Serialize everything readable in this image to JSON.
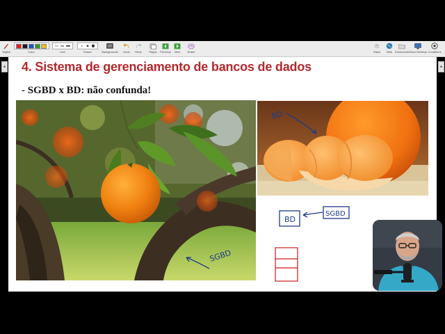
{
  "toolbar": {
    "items": [
      {
        "label": "Digital",
        "icon": "pen-icon"
      },
      {
        "label": "Color",
        "icon": "color-swatches-icon"
      },
      {
        "label": "Line",
        "icon": "line-width-icon"
      },
      {
        "label": "Eraser",
        "icon": "eraser-icon"
      },
      {
        "label": "Backgrounds",
        "icon": "backgrounds-icon"
      },
      {
        "label": "Undo",
        "icon": "undo-icon"
      },
      {
        "label": "Redo",
        "icon": "redo-icon"
      },
      {
        "label": "Pages",
        "icon": "pages-icon"
      },
      {
        "label": "Previous",
        "icon": "previous-icon"
      },
      {
        "label": "Next",
        "icon": "next-icon"
      },
      {
        "label": "Erase",
        "icon": "erase-page-icon"
      },
      {
        "label": "Stack",
        "icon": "stack-icon"
      },
      {
        "label": "Web",
        "icon": "globe-icon"
      },
      {
        "label": "Documents",
        "icon": "folder-icon"
      },
      {
        "label": "Show Desktop",
        "icon": "desktop-icon"
      },
      {
        "label": "Conditions",
        "icon": "settings-icon"
      }
    ],
    "colors": [
      "#e02020",
      "#1a1a1a",
      "#2050d0",
      "#2a9a2a",
      "#e8c020"
    ]
  },
  "slide": {
    "title": "4. Sistema de gerenciamento de bancos de dados",
    "subtitle": "- SGBD x BD: não confunda!",
    "title_color": "#b3282d"
  },
  "annotations": {
    "tree_label": "SGBD",
    "tangerine_label": "BD",
    "diagram_box_left": "BD",
    "diagram_box_right": "SGBD",
    "ink_color": "#1c3a8c",
    "red_ink_color": "#cc1a1a"
  },
  "images": {
    "left": "orange-tree-photo",
    "right": "tangerine-photo"
  },
  "webcam": {
    "label": "presenter-webcam"
  }
}
